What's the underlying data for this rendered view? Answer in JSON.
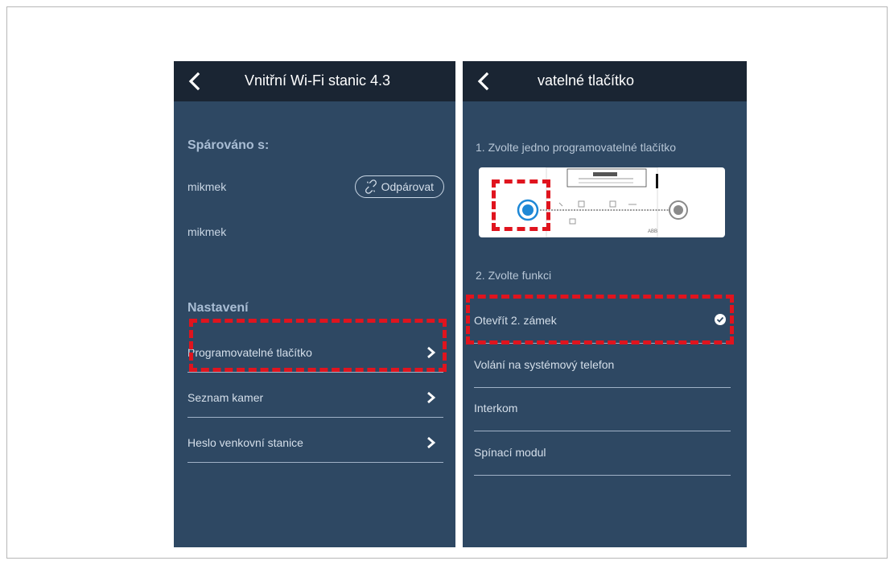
{
  "left_screen": {
    "title": "4.3 Vnitřní Wi-Fi stanic",
    "paired_heading": "Spárováno s:",
    "paired_devices": [
      "mikmek",
      "mikmek"
    ],
    "unpair_label": "Odpárovat",
    "settings_heading": "Nastavení",
    "settings_items": [
      "Programovatelné tlačítko",
      "Seznam kamer",
      "Heslo venkovní stanice"
    ]
  },
  "right_screen": {
    "title": "vatelné tlačítko",
    "step1": "1. Zvolte jedno programovatelné tlačítko",
    "step2": "2. Zvolte funkci",
    "functions": [
      "Otevřít 2. zámek",
      "Volání na systémový telefon",
      "Interkom",
      "Spínací modul"
    ],
    "selected_function": "Otevřít 2. zámek",
    "device_brand": "ABB"
  },
  "colors": {
    "background": "#2e4863",
    "topbar": "#1a2533",
    "highlight": "#e0141e",
    "selected_button": "#1e88d6"
  },
  "icons": {
    "back": "chevron-left-icon",
    "chevron": "chevron-right-icon",
    "unlink": "unlink-icon",
    "check": "check-circle-icon"
  }
}
